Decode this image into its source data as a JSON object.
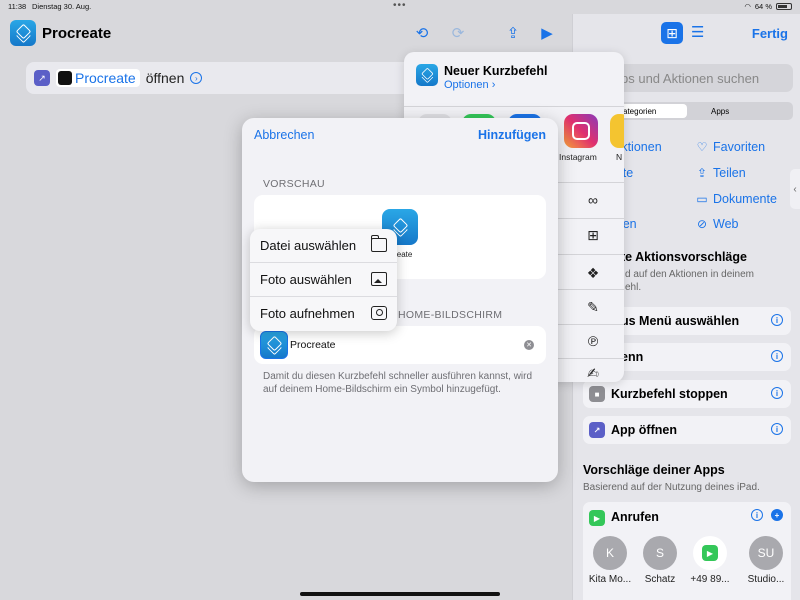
{
  "status": {
    "time": "11:38",
    "date": "Dienstag 30. Aug.",
    "battery": "64 %"
  },
  "editor": {
    "title": "Procreate",
    "action": {
      "app_name": "Procreate",
      "verb": "öffnen"
    }
  },
  "share_sheet": {
    "title": "Neuer Kurzbefehl",
    "options": "Optionen",
    "app_label_instagram": "Instagram",
    "app_label_cut": "N"
  },
  "modal": {
    "cancel": "Abbrechen",
    "add": "Hinzufügen",
    "preview_header": "VORSCHAU",
    "preview_label": "rocreate",
    "name_header": "HOME-BILDSCHIRM",
    "name_value": "Procreate",
    "hint": "Damit du diesen Kurzbefehl schneller ausführen kannst, wird auf deinem Home-Bildschirm ein Symbol hinzugefügt."
  },
  "menu": {
    "items": [
      {
        "label": "Datei auswählen",
        "icon": "folder-icon"
      },
      {
        "label": "Foto auswählen",
        "icon": "photos-icon"
      },
      {
        "label": "Foto aufnehmen",
        "icon": "camera-icon"
      }
    ]
  },
  "sidebar": {
    "done": "Fertig",
    "search_placeholder": "ps und Aktionen suchen",
    "seg_categories": "ategorien",
    "seg_apps": "Apps",
    "cats": {
      "actions": "Aktionen",
      "favorites": "Favoriten",
      "scripts": "ipte",
      "share": "Teilen",
      "documents": "Dokumente",
      "media": "dien",
      "web": "Web"
    },
    "suggest_header": "te Aktionsvorschläge",
    "suggest_sub": "d auf den Aktionen in deinem",
    "suggest_sub2": "ehl.",
    "cards": {
      "menu_select": "us Menü auswählen",
      "card2": "enn",
      "stop": "Kurzbefehl stoppen",
      "open_app": "App öffnen"
    },
    "apps_header": "Vorschläge deiner Apps",
    "apps_sub": "Basierend auf der Nutzung deines iPad.",
    "call": "Anrufen",
    "contacts": [
      {
        "initial": "K",
        "name": "Kita Mo..."
      },
      {
        "initial": "S",
        "name": "Schatz"
      },
      {
        "initial": "",
        "name": "+49 89..."
      },
      {
        "initial": "SU",
        "name": "Studio..."
      }
    ]
  },
  "colors": {
    "accent": "#1a73e8",
    "shortcut_icon": "#1e90d8"
  }
}
